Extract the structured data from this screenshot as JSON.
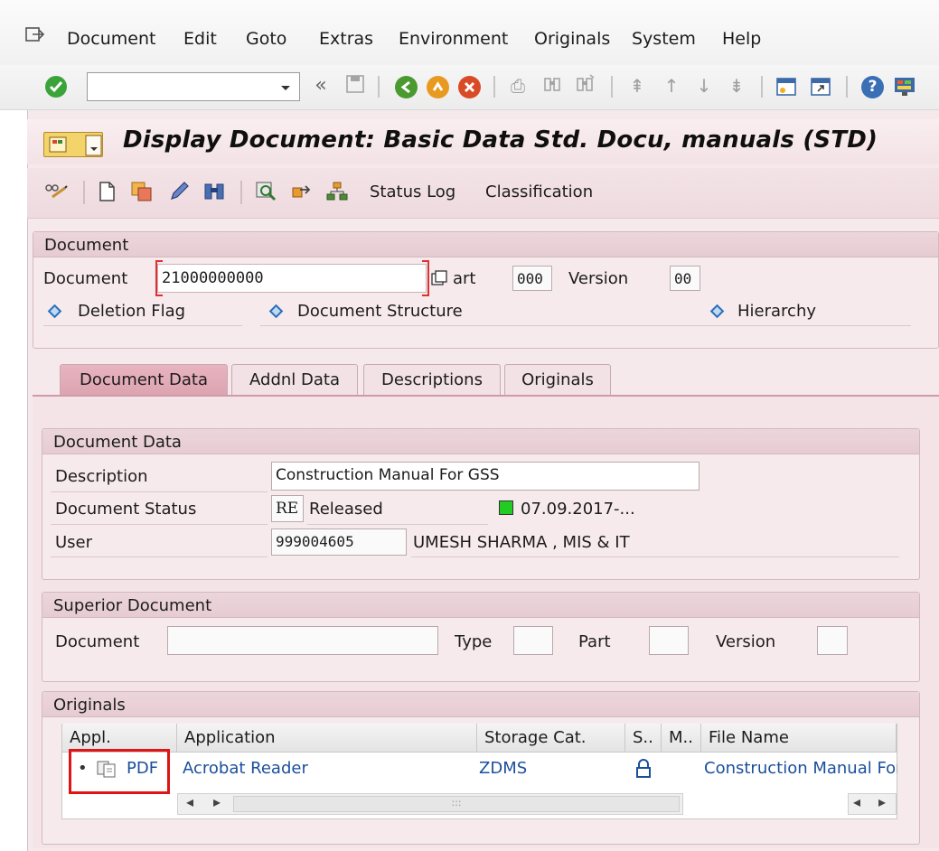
{
  "menu": [
    "Document",
    "Edit",
    "Goto",
    "Extras",
    "Environment",
    "Originals",
    "System",
    "Help"
  ],
  "command_field": {
    "value": ""
  },
  "title": "Display Document: Basic Data Std. Docu,  manuals (STD)",
  "app_toolbar": {
    "status_log": "Status Log",
    "classification": "Classification"
  },
  "document_group": {
    "header": "Document",
    "document_label": "Document",
    "document_value": "21000000000",
    "part_label": "art",
    "part_value": "000",
    "version_label": "Version",
    "version_value": "00",
    "deletion_flag": "Deletion Flag",
    "document_structure": "Document Structure",
    "hierarchy": "Hierarchy"
  },
  "tabs": [
    "Document Data",
    "Addnl Data",
    "Descriptions",
    "Originals"
  ],
  "document_data": {
    "header": "Document Data",
    "description_label": "Description",
    "description_value": "Construction Manual For GSS",
    "status_label": "Document Status",
    "status_code": "RE",
    "status_text": "Released",
    "status_date": "07.09.2017-...",
    "status_color": "#22cc22",
    "user_label": "User",
    "user_id": "999004605",
    "user_name": "UMESH SHARMA , MIS & IT"
  },
  "superior_document": {
    "header": "Superior Document",
    "document_label": "Document",
    "type_label": "Type",
    "part_label": "Part",
    "version_label": "Version"
  },
  "originals": {
    "header": "Originals",
    "columns": [
      "Appl.",
      "Application",
      "Storage Cat.",
      "S..",
      "M..",
      "File Name"
    ],
    "row": {
      "bullet": "•",
      "appl": "PDF",
      "application": "Acrobat Reader",
      "storage": "ZDMS",
      "file_name": "Construction Manual For"
    },
    "scroll_left": "◂",
    "scroll_right": "▸",
    "scroll_grip": ":::"
  },
  "colors": {
    "accent_red": "#e01414",
    "link_blue": "#1a4f9c",
    "panel_pink": "#f6e9ec"
  }
}
